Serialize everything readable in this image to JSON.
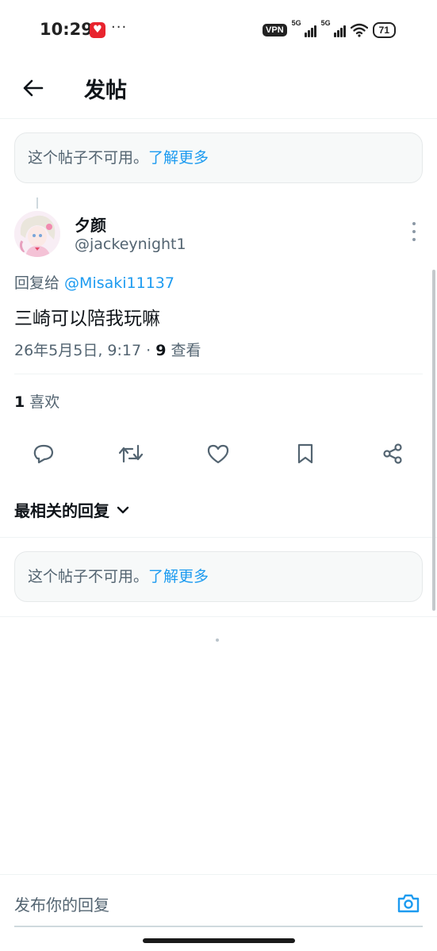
{
  "status_bar": {
    "time": "10:29",
    "dots": "···",
    "vpn": "VPN",
    "network_1": "5G",
    "network_2": "5G",
    "battery": "71"
  },
  "header": {
    "title": "发帖"
  },
  "unavailable_top": {
    "text": "这个帖子不可用。",
    "link": "了解更多"
  },
  "tweet": {
    "author_name": "夕颜",
    "author_handle": "@jackeynight1",
    "reply_prefix": "回复给 ",
    "reply_mention": "@Misaki11137",
    "text": "三崎可以陪我玩嘛",
    "timestamp": "26年5月5日, 9:17 · ",
    "view_count": "9",
    "view_label": " 查看",
    "like_count": "1",
    "like_label": " 喜欢"
  },
  "actions": [
    "reply-icon",
    "retweet-icon",
    "like-icon",
    "bookmark-icon",
    "share-icon"
  ],
  "sort": {
    "label": "最相关的回复"
  },
  "unavailable_reply": {
    "text": "这个帖子不可用。",
    "link": "了解更多"
  },
  "reply_bar": {
    "placeholder": "发布你的回复"
  },
  "colors": {
    "accent": "#1d9bf0",
    "text_primary": "#0f1419",
    "text_secondary": "#536471",
    "divider": "#eff3f4"
  }
}
